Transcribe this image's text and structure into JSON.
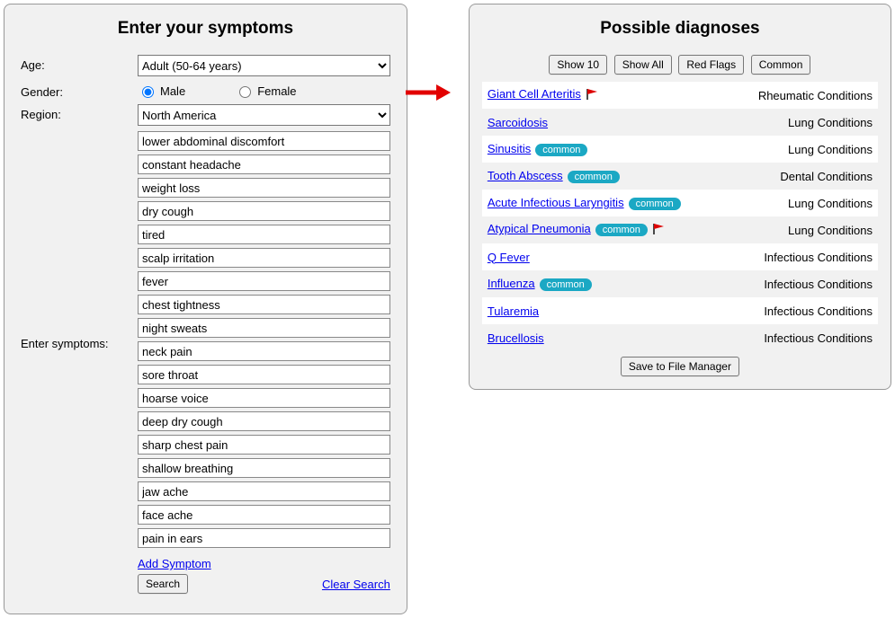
{
  "left": {
    "title": "Enter your symptoms",
    "age_label": "Age:",
    "age_value": "Adult (50-64 years)",
    "gender_label": "Gender:",
    "gender_male": "Male",
    "gender_female": "Female",
    "region_label": "Region:",
    "region_value": "North America",
    "symptoms_label": "Enter symptoms:",
    "symptoms": [
      "lower abdominal discomfort",
      "constant headache",
      "weight loss",
      "dry cough",
      "tired",
      "scalp irritation",
      "fever",
      "chest tightness",
      "night sweats",
      "neck pain",
      "sore throat",
      "hoarse voice",
      "deep dry cough",
      "sharp chest pain",
      "shallow breathing",
      "jaw ache",
      "face ache",
      "pain in ears"
    ],
    "add_symptom": "Add Symptom",
    "search": "Search",
    "clear_search": "Clear Search"
  },
  "right": {
    "title": "Possible diagnoses",
    "filters": {
      "show10": "Show 10",
      "show_all": "Show All",
      "red_flags": "Red Flags",
      "common": "Common"
    },
    "diagnoses": [
      {
        "name": "Giant Cell Arteritis",
        "category": "Rheumatic Conditions",
        "common": false,
        "flag": true
      },
      {
        "name": "Sarcoidosis",
        "category": "Lung Conditions",
        "common": false,
        "flag": false
      },
      {
        "name": "Sinusitis",
        "category": "Lung Conditions",
        "common": true,
        "flag": false
      },
      {
        "name": "Tooth Abscess",
        "category": "Dental Conditions",
        "common": true,
        "flag": false
      },
      {
        "name": "Acute Infectious Laryngitis",
        "category": "Lung Conditions",
        "common": true,
        "flag": false
      },
      {
        "name": "Atypical Pneumonia",
        "category": "Lung Conditions",
        "common": true,
        "flag": true
      },
      {
        "name": "Q Fever",
        "category": "Infectious Conditions",
        "common": false,
        "flag": false
      },
      {
        "name": "Influenza",
        "category": "Infectious Conditions",
        "common": true,
        "flag": false
      },
      {
        "name": "Tularemia",
        "category": "Infectious Conditions",
        "common": false,
        "flag": false
      },
      {
        "name": "Brucellosis",
        "category": "Infectious Conditions",
        "common": false,
        "flag": false
      }
    ],
    "common_badge": "common",
    "save": "Save to File Manager"
  }
}
